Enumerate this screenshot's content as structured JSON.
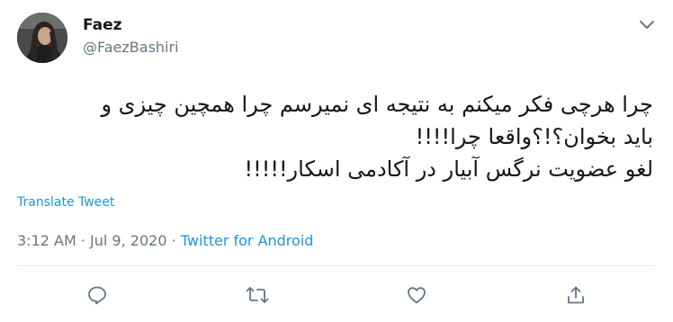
{
  "author": {
    "name": "Faez",
    "handle": "@FaezBashiri"
  },
  "tweet": {
    "lines": [
      "چرا هرچی فکر میکنم به نتیجه ای نمیرسم چرا همچین چیزی و",
      "باید بخوان؟!؟واقعا چرا!!!!",
      "لغو عضویت نرگس آبیار در آکادمی اسکار!!!!!"
    ]
  },
  "translate_label": "Translate Tweet",
  "meta": {
    "time": "3:12 AM",
    "separator1": " · ",
    "date": "Jul 9, 2020",
    "separator2": " · ",
    "source": "Twitter for Android"
  },
  "icons": {
    "reply": "reply-icon",
    "retweet": "retweet-icon",
    "like": "like-icon",
    "share": "share-icon",
    "caret": "chevron-down-icon"
  },
  "colors": {
    "text": "#14171a",
    "secondary": "#657786",
    "link": "#1b95e0",
    "divider": "#e6ecf0"
  }
}
